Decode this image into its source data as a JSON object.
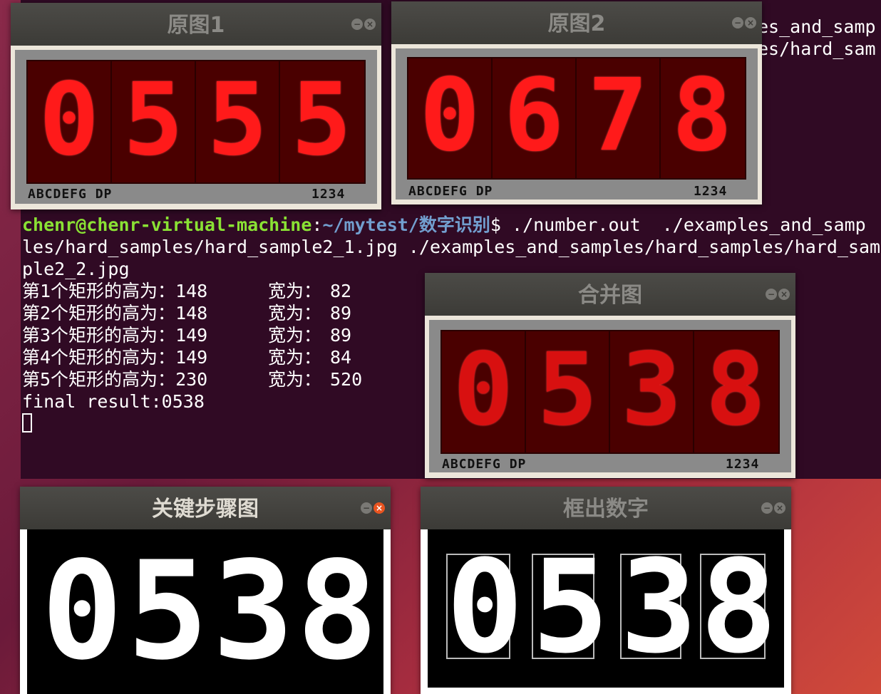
{
  "terminal": {
    "top_fragment_left": "es_and_samp",
    "top_fragment_left2": "es/hard_sam",
    "prompt_user": "chenr@chenr-virtual-machine",
    "prompt_sep": ":",
    "prompt_path": "~/mytest/数字识别",
    "prompt_cmd": "$ ./number.out  ./examples_and_samp",
    "line2": "les/hard_samples/hard_sample2_1.jpg ./examples_and_samples/hard_samples/hard_sam",
    "line3": "ple2_2.jpg",
    "rects": [
      {
        "label": "第1个矩形的高为：",
        "h": "148",
        "wlabel": "宽为：",
        "w": "82"
      },
      {
        "label": "第2个矩形的高为：",
        "h": "148",
        "wlabel": "宽为：",
        "w": "89"
      },
      {
        "label": "第3个矩形的高为：",
        "h": "149",
        "wlabel": "宽为：",
        "w": "89"
      },
      {
        "label": "第4个矩形的高为：",
        "h": "149",
        "wlabel": "宽为：",
        "w": "84"
      },
      {
        "label": "第5个矩形的高为：",
        "h": "230",
        "wlabel": "宽为：",
        "w": "520"
      }
    ],
    "final": "final result:0538"
  },
  "windows": {
    "orig1": {
      "title": "原图1",
      "digits": [
        "0",
        "5",
        "5",
        "5"
      ],
      "pins": "ABCDEFG DP",
      "nums": "1234"
    },
    "orig2": {
      "title": "原图2",
      "digits": [
        "0",
        "6",
        "7",
        "8"
      ],
      "pins": "ABCDEFG DP",
      "nums": "1234"
    },
    "merged": {
      "title": "合并图",
      "digits": [
        "0",
        "5",
        "3",
        "8"
      ],
      "pins": "ABCDEFG DP",
      "nums": "1234"
    },
    "steps": {
      "title": "关键步骤图",
      "digits": [
        "0",
        "5",
        "3",
        "8"
      ]
    },
    "boxes": {
      "title": "框出数字",
      "digits": [
        "0",
        "5",
        "3",
        "8"
      ]
    }
  },
  "icons": {
    "minimize": "minimize-icon",
    "close": "close-icon"
  },
  "colors": {
    "terminal_bg": "#300a24",
    "prompt_green": "#8ae234",
    "prompt_blue": "#729fcf",
    "seg_red": "#ff1a1a",
    "ubuntu_orange": "#e95420"
  }
}
